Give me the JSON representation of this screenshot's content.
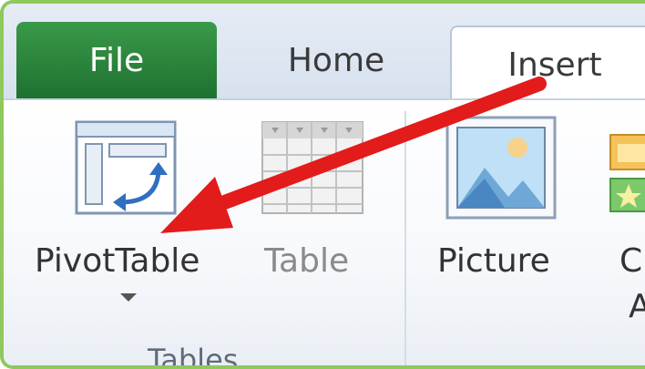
{
  "tabs": [
    {
      "label": "File"
    },
    {
      "label": "Home"
    },
    {
      "label": "Insert"
    }
  ],
  "ribbon": {
    "buttons": [
      {
        "label": "PivotTable"
      },
      {
        "label": "Table"
      },
      {
        "label": "Picture"
      },
      {
        "label_line1": "Cl",
        "label_line2": "A"
      }
    ],
    "group_label": "Tables"
  },
  "colors": {
    "file_tab": "#2e8b3f",
    "frame_border": "#8fc95e",
    "annotation_arrow": "#e21b1b"
  },
  "icons": [
    "pivottable-icon",
    "table-icon",
    "picture-icon",
    "clipart-icon",
    "dropdown-icon",
    "annotation-arrow"
  ]
}
